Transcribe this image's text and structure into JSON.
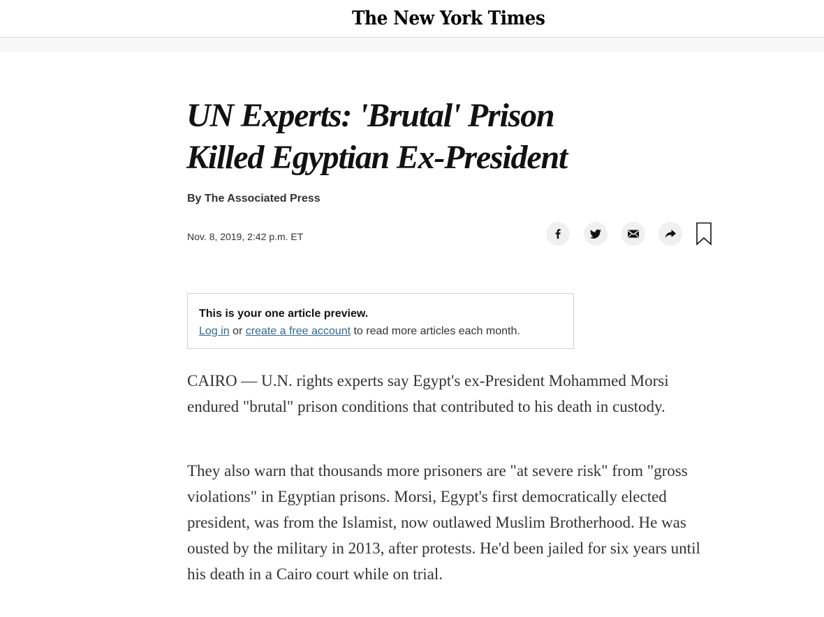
{
  "masthead": {
    "logo_text": "The New York Times"
  },
  "article": {
    "headline": "UN Experts: 'Brutal' Prison Killed Egyptian Ex-President",
    "byline": "By The Associated Press",
    "date": "Nov. 8, 2019, 2:42 p.m. ET",
    "paragraphs": [
      "CAIRO — U.N. rights experts say Egypt's ex-President Mohammed Morsi endured \"brutal\" prison conditions that contributed to his death in custody.",
      "They also warn that thousands more prisoners are \"at severe risk\" from \"gross violations\" in Egyptian prisons. Morsi, Egypt's first democratically elected president, was from the Islamist, now outlawed Muslim Brotherhood. He was ousted by the military in 2013, after protests. He'd been jailed for six years until his death in a Cairo court while on trial."
    ]
  },
  "share": {
    "icons": [
      "facebook-icon",
      "twitter-icon",
      "email-icon",
      "share-icon",
      "bookmark-icon"
    ],
    "icon_color": "#121212",
    "circle_color": "#f0f0f0"
  },
  "preview": {
    "title": "This is your one article preview.",
    "login_link": "Log in",
    "or_text": " or ",
    "create_link": "create a free account",
    "suffix": " to read more articles each month.",
    "link_color": "#326891"
  }
}
